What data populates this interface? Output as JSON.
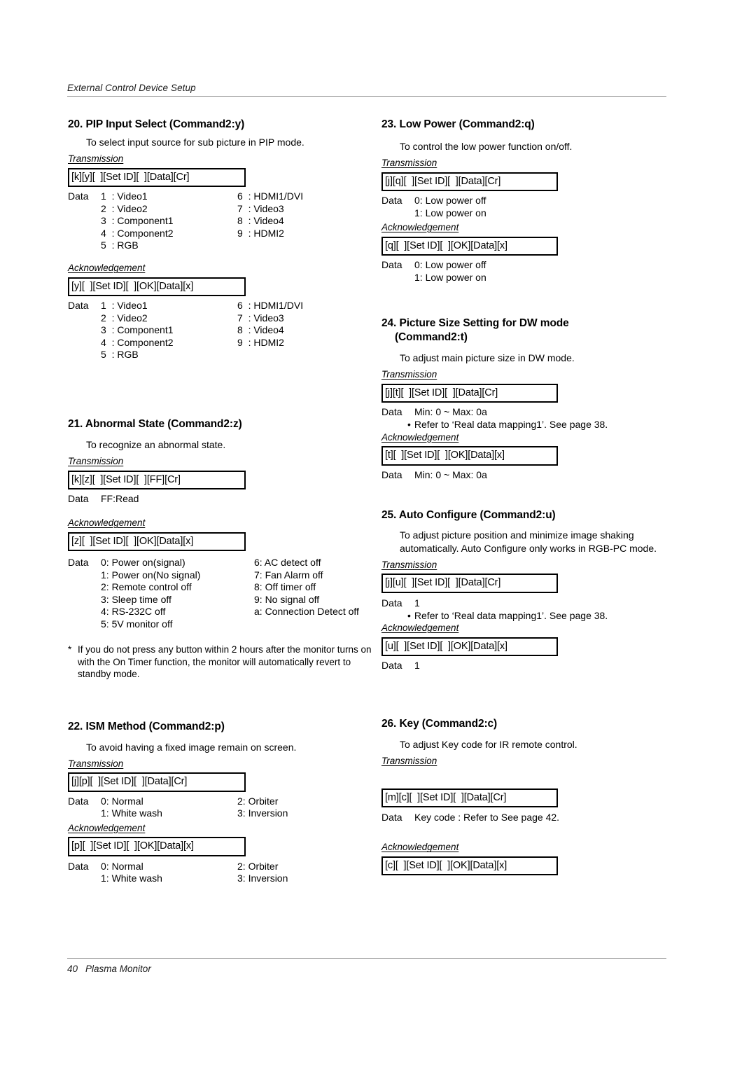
{
  "header": {
    "running_title": "External Control Device Setup"
  },
  "footer": {
    "page_number": "40",
    "product": "Plasma Monitor"
  },
  "labels": {
    "transmission": "Transmission",
    "acknowledgement": "Acknowledgement",
    "data": "Data"
  },
  "left_column": {
    "s20": {
      "title": "20. PIP Input Select (Command2:y)",
      "desc": "To select input source for sub picture in PIP mode.",
      "tx_box": "[k][y][  ][Set ID][  ][Data][Cr]",
      "tx_data_col_a": [
        "1  : Video1",
        "2  : Video2",
        "3  : Component1",
        "4  : Component2",
        "5  : RGB"
      ],
      "tx_data_col_b": [
        "6  : HDMI1/DVI",
        "7  : Video3",
        "8  : Video4",
        "9  : HDMI2"
      ],
      "ack_box": "[y][  ][Set ID][  ][OK][Data][x]",
      "ack_data_col_a": [
        "1  : Video1",
        "2  : Video2",
        "3  : Component1",
        "4  : Component2",
        "5  : RGB"
      ],
      "ack_data_col_b": [
        "6  : HDMI1/DVI",
        "7  : Video3",
        "8  : Video4",
        "9  : HDMI2"
      ]
    },
    "s21": {
      "title": "21. Abnormal State (Command2:z)",
      "desc": "To recognize an abnormal state.",
      "tx_box": "[k][z][  ][Set ID][  ][FF][Cr]",
      "tx_data": "FF:Read",
      "ack_box": "[z][  ][Set ID][  ][OK][Data][x]",
      "ack_data_col_a": [
        "0: Power on(signal)",
        "1: Power on(No signal)",
        "2: Remote control off",
        "3: Sleep time off",
        "4: RS-232C off",
        "5: 5V monitor off"
      ],
      "ack_data_col_b": [
        "6: AC detect off",
        "7: Fan Alarm off",
        "8: Off timer off",
        "9: No signal off",
        "a: Connection Detect off"
      ],
      "footnote_star": "*",
      "footnote": "If you do not press any button within 2 hours after the monitor turns on with the On Timer function, the monitor will automatically revert to standby mode."
    },
    "s22": {
      "title": "22. ISM Method (Command2:p)",
      "desc": "To avoid having a fixed image remain on screen.",
      "tx_box": "[j][p][  ][Set ID][  ][Data][Cr]",
      "tx_data_col_a": [
        "0: Normal",
        "1: White wash"
      ],
      "tx_data_col_b": [
        "2: Orbiter",
        "3: Inversion"
      ],
      "ack_box": "[p][  ][Set ID][  ][OK][Data][x]",
      "ack_data_col_a": [
        "0: Normal",
        "1: White wash"
      ],
      "ack_data_col_b": [
        "2: Orbiter",
        "3: Inversion"
      ]
    }
  },
  "right_column": {
    "s23": {
      "title": "23. Low Power (Command2:q)",
      "desc": "To control the low power function on/off.",
      "tx_box": "[j][q][  ][Set ID][  ][Data][Cr]",
      "tx_data_col_a": [
        "0: Low power off",
        "1: Low power on"
      ],
      "ack_box": "[q][  ][Set ID][  ][OK][Data][x]",
      "ack_data_col_a": [
        "0: Low power off",
        "1: Low power on"
      ]
    },
    "s24": {
      "title_line1": "24. Picture Size Setting for DW mode",
      "title_line2": "(Command2:t)",
      "desc": "To adjust main picture size in DW mode.",
      "tx_box": "[j][t][  ][Set ID][  ][Data][Cr]",
      "tx_data": "Min: 0 ~ Max: 0a",
      "bullet": "Refer to ‘Real data mapping1’. See page 38.",
      "ack_box": "[t][  ][Set ID][  ][OK][Data][x]",
      "ack_data": "Min: 0 ~ Max: 0a"
    },
    "s25": {
      "title": "25. Auto Configure (Command2:u)",
      "desc": "To adjust picture position and minimize image shaking automatically. Auto Configure only works in RGB-PC mode.",
      "tx_box": "[j][u][  ][Set ID][  ][Data][Cr]",
      "tx_data": "1",
      "bullet": "Refer to ‘Real data mapping1’. See page 38.",
      "ack_box": "[u][  ][Set ID][  ][OK][Data][x]",
      "ack_data": "1"
    },
    "s26": {
      "title": "26. Key (Command2:c)",
      "desc": "To adjust Key code for IR remote control.",
      "tx_box": "[m][c][  ][Set ID][  ][Data][Cr]",
      "tx_data": "Key code : Refer to See page 42.",
      "ack_box": "[c][  ][Set ID][  ][OK][Data][x]"
    }
  }
}
